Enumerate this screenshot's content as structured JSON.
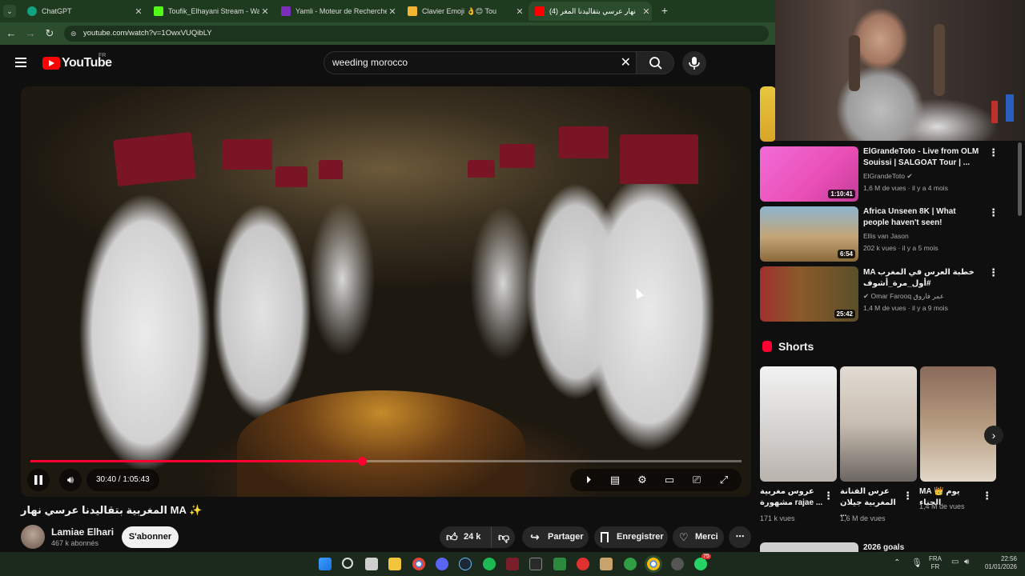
{
  "browser": {
    "tabs": [
      {
        "label": "ChatGPT",
        "color": "#10a37f"
      },
      {
        "label": "Toufik_Elhayani Stream - Watch",
        "color": "#53fc18"
      },
      {
        "label": "Yamli - Moteur de Recherche A",
        "color": "#7b2fbf"
      },
      {
        "label": "Clavier Emoji 👌😊 Tou",
        "color": "#f2b632"
      },
      {
        "label": "(4) نهار عرسي بتقاليدنا المغر",
        "color": "#ff0000"
      }
    ],
    "new_tab": "+",
    "url": "youtube.com/watch?v=1OwxVUQibLY"
  },
  "youtube": {
    "logo_text": "YouTube",
    "country": "FR",
    "search_value": "weeding morocco",
    "video": {
      "time": "30:40 / 1:05:43",
      "progress": 0.4667,
      "title": "المغربية بتقاليدنا عرسي نهار MA ✨",
      "channel": "Lamiae Elhari",
      "subscribers": "467 k abonnés",
      "subscribe_label": "S'abonner",
      "likes": "24 k",
      "share_label": "Partager",
      "save_label": "Enregistrer",
      "thanks_label": "Merci"
    },
    "sidebar": {
      "items": [
        {
          "title": "ElGrandeToto  - Live from OLM Souissi | SALGOAT Tour | ...",
          "channel": "ElGrandeToto",
          "meta": "1,6 M de vues · il y a 4 mois",
          "duration": "1:10:41"
        },
        {
          "title": "Africa Unseen 8K | What people haven't seen!",
          "channel": "Ellis van Jason",
          "meta": "202 k vues · il y a 5 mois",
          "duration": "6:54"
        },
        {
          "title": "MA خطبة العرس في المغرب #أول_مرة_أشوف",
          "channel": "Omar Farooq عمر فاروق",
          "meta": "1,4 M de vues · il y a 9 mois",
          "duration": "25:42"
        }
      ],
      "shorts_heading": "Shorts",
      "shorts": [
        {
          "title": "عروس مغربية مشهورة rajae ...",
          "views": "171 k vues"
        },
        {
          "title": "عرس الفنانة المغربية جيلان ...",
          "views": "1,6 M de vues"
        },
        {
          "title": "MA 👑 يوم الحناء",
          "views": "1,4 M de vues"
        }
      ],
      "next_title": "2026 goals"
    }
  },
  "taskbar": {
    "lang": "FRA",
    "lang2": "FR",
    "time": "22:56",
    "date": "01/01/2026",
    "badge": "75"
  },
  "colors": {
    "accent": "#ff0033",
    "browser_frame": "#2c4d2d"
  }
}
